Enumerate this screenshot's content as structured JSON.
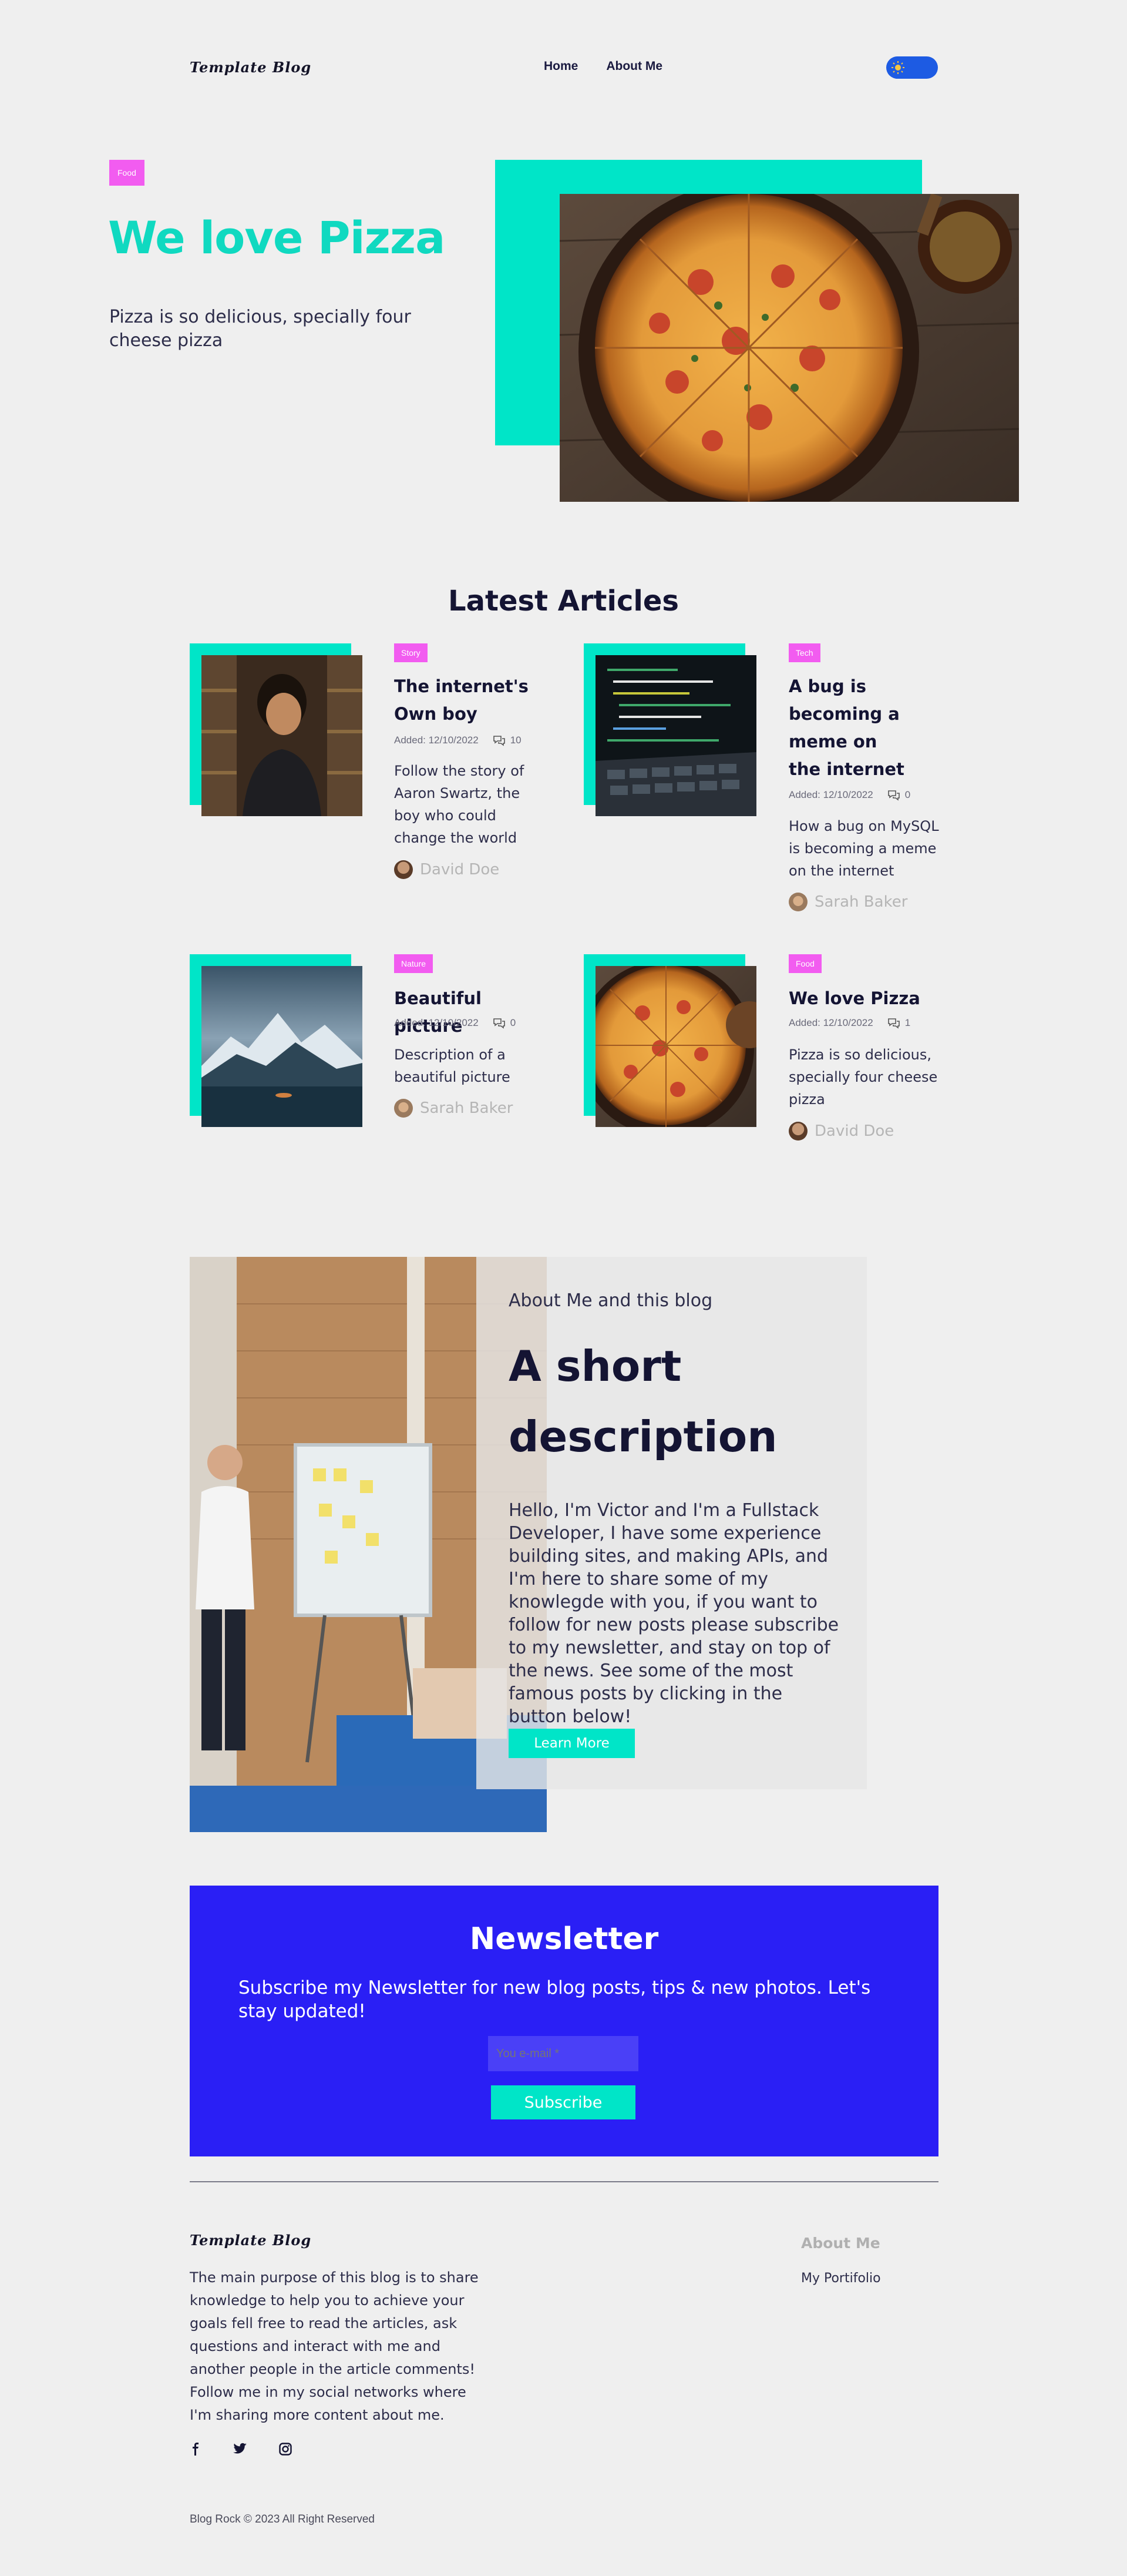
{
  "header": {
    "logo": "Template Blog",
    "nav": [
      "Home",
      "About Me"
    ],
    "theme_toggle_icon": "sun-icon"
  },
  "hero": {
    "badge": "Food",
    "title": "We love Pizza",
    "subtitle": "Pizza is so delicious, specially four cheese pizza",
    "image": "pizza-photo"
  },
  "latest": {
    "title": "Latest Articles",
    "articles": [
      {
        "badge": "Story",
        "title": "The internet's Own boy",
        "date": "Added: 12/10/2022",
        "comments": "10",
        "description": "Follow the story of Aaron Swartz, the boy who could change the world",
        "author": "David Doe",
        "image": "reading-man-photo"
      },
      {
        "badge": "Tech",
        "title": "A bug is becoming a meme on the internet",
        "date": "Added: 12/10/2022",
        "comments": "0",
        "description": "How a bug on MySQL is becoming a meme on the internet",
        "author": "Sarah Baker",
        "image": "laptop-code-photo"
      },
      {
        "badge": "Nature",
        "title": "Beautiful picture",
        "date": "Added: 12/10/2022",
        "comments": "0",
        "description": "Description of a beautiful picture",
        "author": "Sarah Baker",
        "image": "mountain-lake-photo"
      },
      {
        "badge": "Food",
        "title": "We love Pizza",
        "date": "Added: 12/10/2022",
        "comments": "1",
        "description": "Pizza is so delicious, specially four cheese pizza",
        "author": "David Doe",
        "image": "pizza-photo"
      }
    ]
  },
  "about": {
    "kicker": "About Me and this blog",
    "title": "A short description",
    "body": "Hello, I'm Victor and I'm a Fullstack Developer, I have some experience building sites, and making APIs, and I'm here to share some of my knowlegde with you, if you want to follow for new posts please subscribe to my newsletter, and stay on top of the news. See some of the most famous posts by clicking in the button below!",
    "button": "Learn More",
    "image": "office-whiteboard-photo"
  },
  "newsletter": {
    "title": "Newsletter",
    "subtitle": "Subscribe my Newsletter for new blog posts, tips & new photos. Let's stay updated!",
    "email_placeholder": "You e-mail *",
    "button": "Subscribe"
  },
  "footer": {
    "logo": "Template Blog",
    "text": "The main purpose of this blog is to share knowledge to help you to achieve your goals fell free to read the articles, ask questions and interact with me and another people in the article comments! Follow me in my social networks where I'm sharing more content about me.",
    "social_icons": [
      "facebook-icon",
      "twitter-icon",
      "instagram-icon"
    ],
    "about_heading": "About Me",
    "about_link": "My Portifolio",
    "copyright": "Blog Rock © 2023 All Right Reserved"
  },
  "colors": {
    "accent_teal": "#00e5c8",
    "badge_pink": "#f25cf0",
    "newsletter_blue": "#2a1ff5",
    "toggle_blue": "#1d5be3",
    "background": "#efefef",
    "text_dark": "#141433"
  }
}
